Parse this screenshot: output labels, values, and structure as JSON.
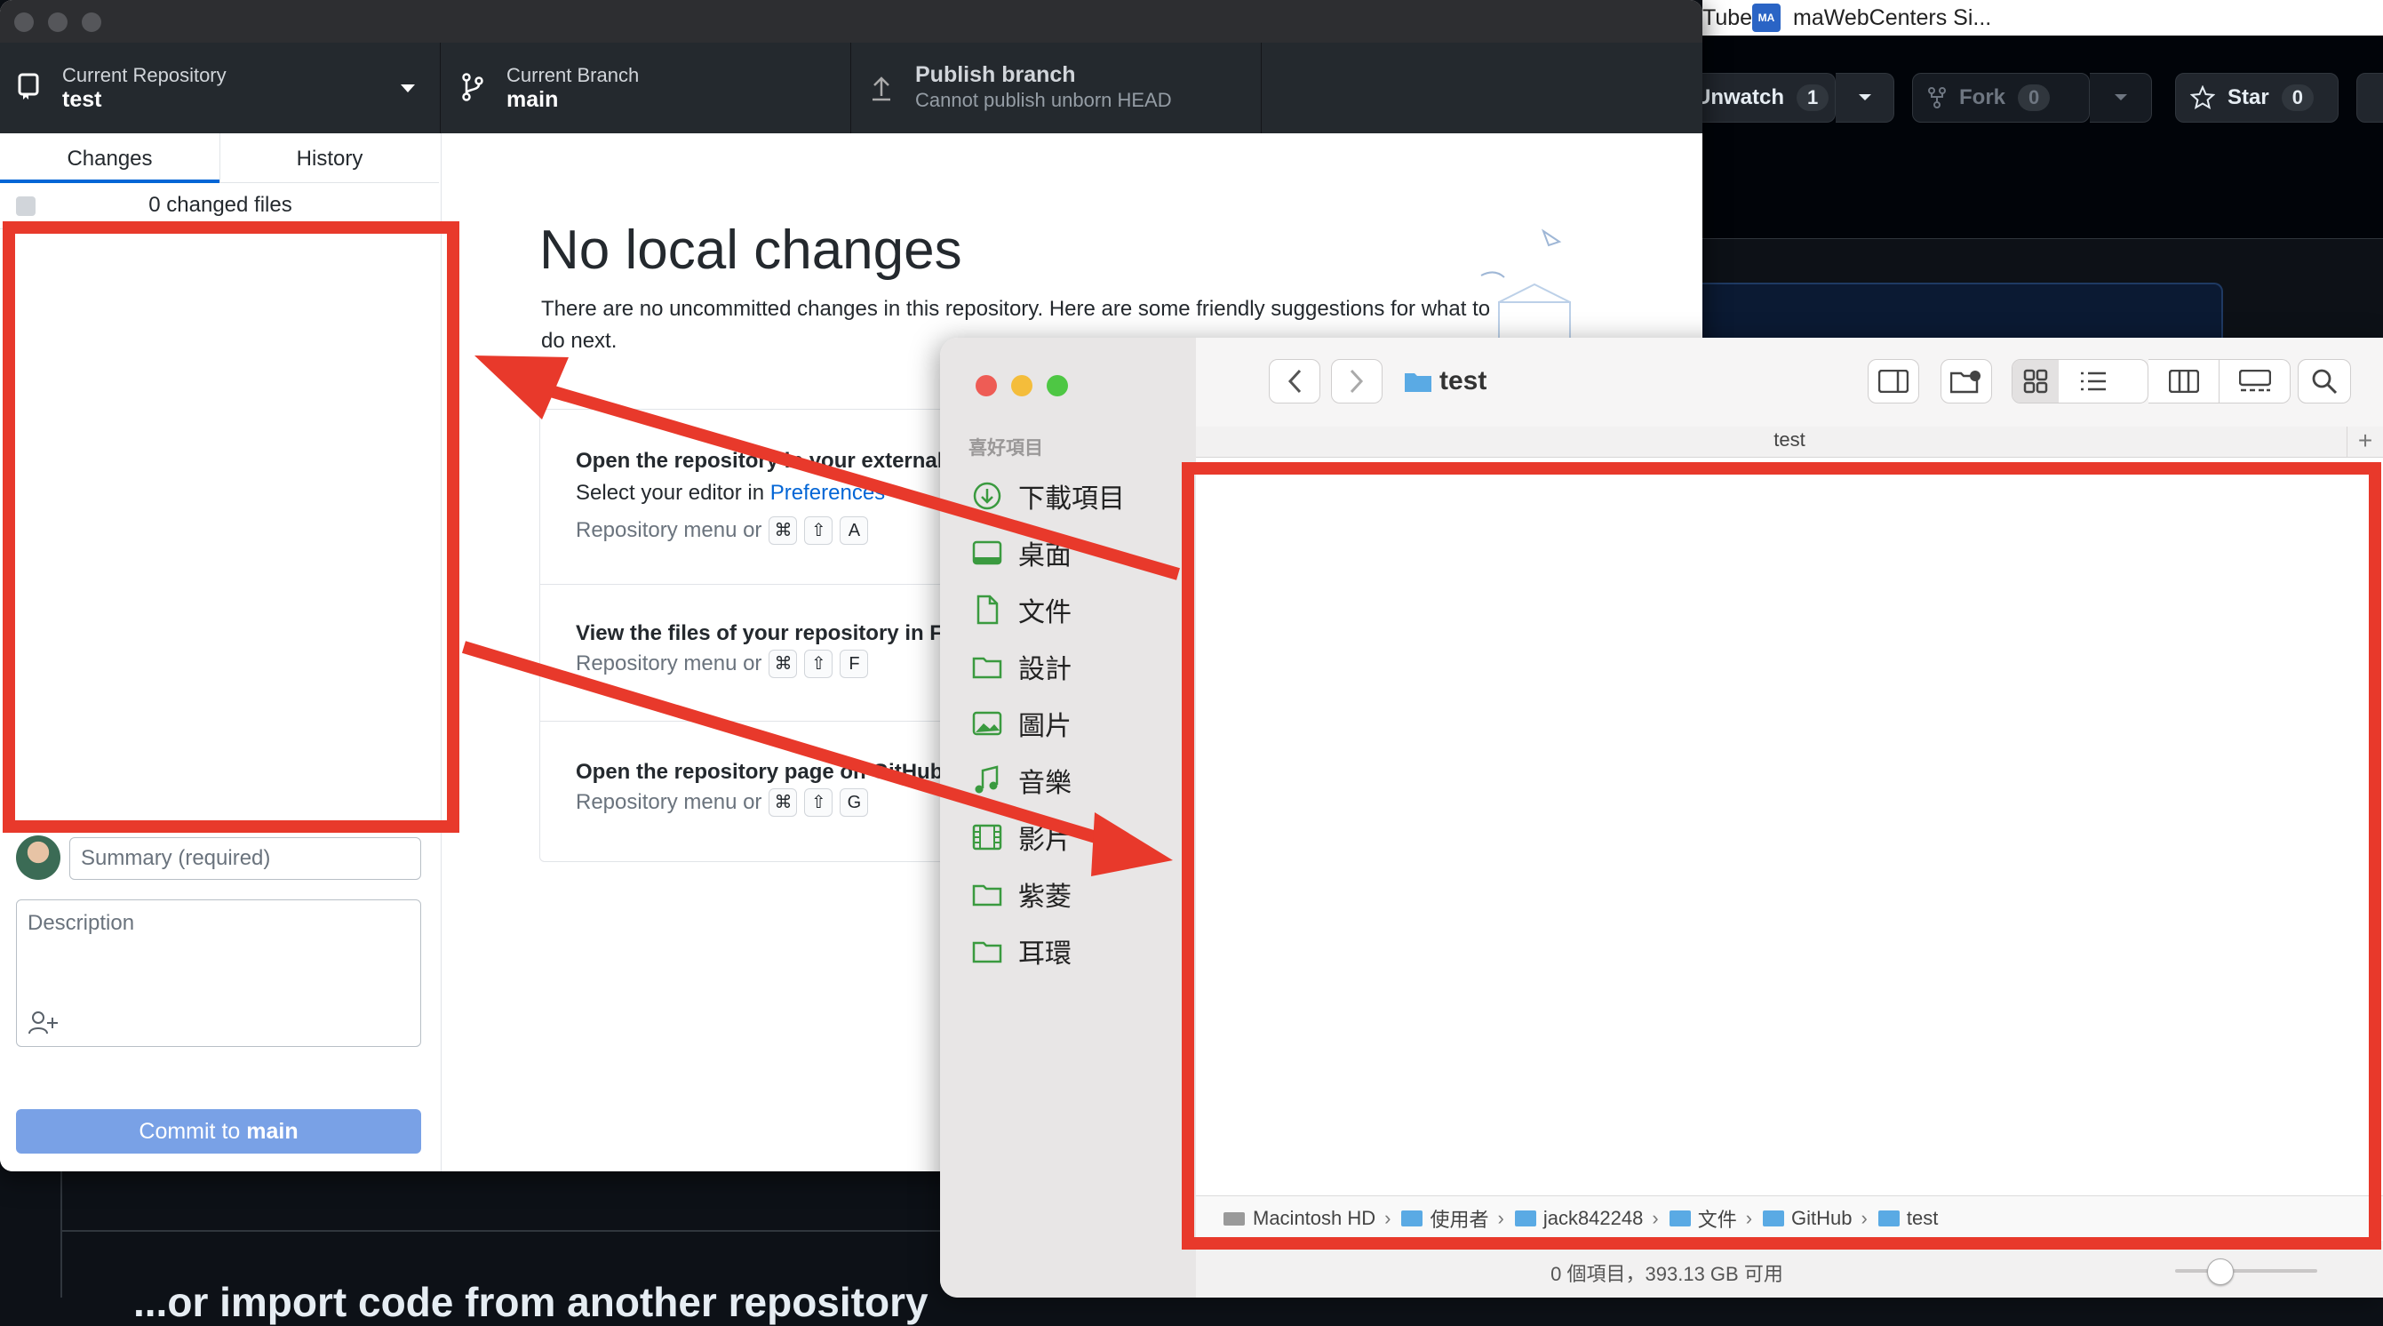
{
  "browser": {
    "tab_youtube": "Tube",
    "tab_mawebcenters": "maWebCenters Si...",
    "tab_icon_text": "MA"
  },
  "github_page": {
    "unwatch_label": "Unwatch",
    "unwatch_count": "1",
    "fork_label": "Fork",
    "fork_count": "0",
    "star_label": "Star",
    "star_count": "0",
    "import_heading": "...or import code from another repository"
  },
  "desktop": {
    "toolbar": {
      "repo_label": "Current Repository",
      "repo_value": "test",
      "branch_label": "Current Branch",
      "branch_value": "main",
      "publish_label": "Publish branch",
      "publish_sub": "Cannot publish unborn HEAD"
    },
    "tabs": [
      "Changes",
      "History"
    ],
    "changed_files": "0 changed files",
    "summary_placeholder": "Summary (required)",
    "description_placeholder": "Description",
    "commit_prefix": "Commit to ",
    "commit_branch": "main",
    "main": {
      "title": "No local changes",
      "subtitle": "There are no uncommitted changes in this repository. Here are some friendly suggestions for what to do next.",
      "card1_title": "Open the repository in your external editor",
      "card1_text_prefix": "Select your editor in ",
      "card1_link": "Preferences",
      "card1_hint": "Repository menu or",
      "card1_keys": [
        "⌘",
        "⇧",
        "A"
      ],
      "card2_title": "View the files of your repository in Finder",
      "card2_hint": "Repository menu or",
      "card2_keys": [
        "⌘",
        "⇧",
        "F"
      ],
      "card3_title": "Open the repository page on GitHub in your browser",
      "card3_hint": "Repository menu or",
      "card3_keys": [
        "⌘",
        "⇧",
        "G"
      ]
    }
  },
  "finder": {
    "title": "test",
    "tab_name": "test",
    "favorites_header": "喜好項目",
    "sidebar_items": [
      "下載項目",
      "桌面",
      "文件",
      "設計",
      "圖片",
      "音樂",
      "影片",
      "紫菱",
      "耳環"
    ],
    "path": [
      "Macintosh HD",
      "使用者",
      "jack842248",
      "文件",
      "GitHub",
      "test"
    ],
    "status": "0 個項目，393.13 GB 可用"
  },
  "colors": {
    "annotation_red": "#e8392b",
    "github_blue": "#0366d6",
    "commit_button": "#79a1e6",
    "finder_folder": "#5aaae4"
  }
}
